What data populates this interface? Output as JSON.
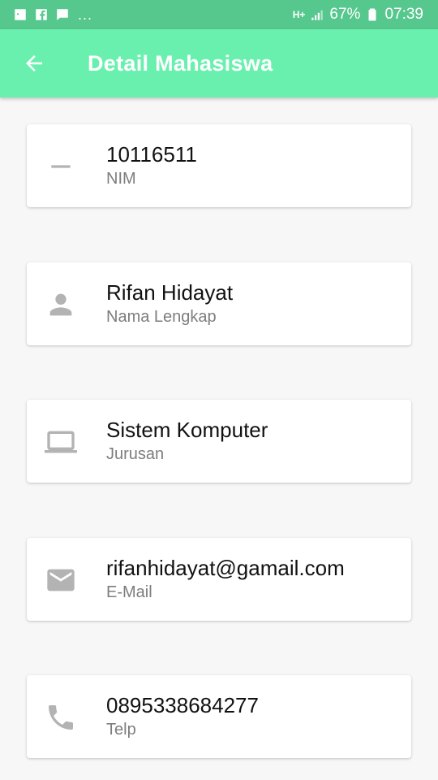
{
  "status_bar": {
    "left_icons": [
      "image-icon",
      "facebook-icon",
      "chat-icon"
    ],
    "overflow": "...",
    "network": "H+",
    "battery": "67%",
    "time": "07:39"
  },
  "app_bar": {
    "back_icon": "arrow-back-icon",
    "title": "Detail Mahasiswa"
  },
  "details": [
    {
      "icon": "remove-icon",
      "value": "10116511",
      "label": "NIM"
    },
    {
      "icon": "person-icon",
      "value": "Rifan Hidayat",
      "label": "Nama Lengkap"
    },
    {
      "icon": "laptop-icon",
      "value": "Sistem Komputer",
      "label": "Jurusan"
    },
    {
      "icon": "email-icon",
      "value": "rifanhidayat@gamail.com",
      "label": "E-Mail"
    },
    {
      "icon": "phone-icon",
      "value": "0895338684277",
      "label": "Telp"
    }
  ],
  "colors": {
    "status_bar": "#56c88e",
    "app_bar": "#69f0ae",
    "background": "#f7f7f7",
    "card": "#ffffff",
    "icon": "#b3b3b3",
    "title_text": "#111111",
    "subtitle_text": "#7d7d7d"
  }
}
